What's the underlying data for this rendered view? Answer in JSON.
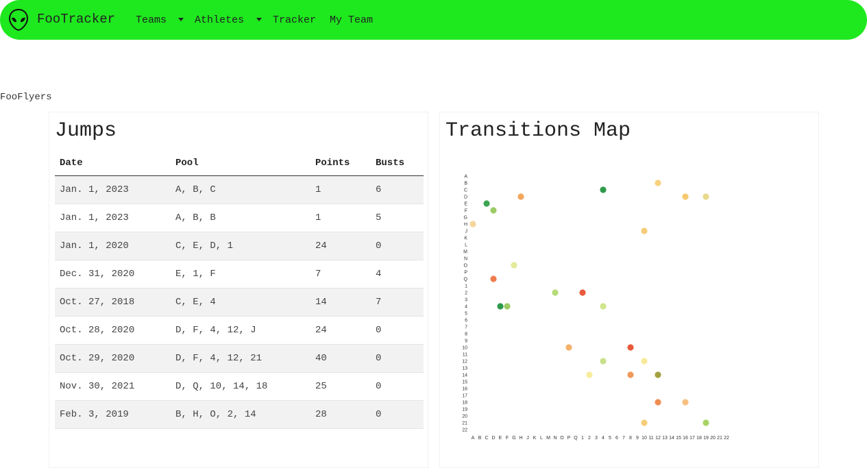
{
  "nav": {
    "brand": "FooTracker",
    "logo_icon": "alien-head-icon",
    "items": [
      {
        "label": "Teams",
        "dropdown": true
      },
      {
        "label": "Athletes",
        "dropdown": true
      },
      {
        "label": "Tracker",
        "dropdown": false
      },
      {
        "label": "My Team",
        "dropdown": false
      }
    ],
    "color": "#1ee81e"
  },
  "team_name": "FooFlyers",
  "jumps": {
    "title": "Jumps",
    "columns": [
      "Date",
      "Pool",
      "Points",
      "Busts"
    ],
    "rows": [
      [
        "Jan. 1, 2023",
        "A, B, C",
        "1",
        "6"
      ],
      [
        "Jan. 1, 2023",
        "A, B, B",
        "1",
        "5"
      ],
      [
        "Jan. 1, 2020",
        "C, E, D, 1",
        "24",
        "0"
      ],
      [
        "Dec. 31, 2020",
        "E, 1, F",
        "7",
        "4"
      ],
      [
        "Oct. 27, 2018",
        "C, E, 4",
        "14",
        "7"
      ],
      [
        "Oct. 28, 2020",
        "D, F, 4, 12, J",
        "24",
        "0"
      ],
      [
        "Oct. 29, 2020",
        "D, F, 4, 12, 21",
        "40",
        "0"
      ],
      [
        "Nov. 30, 2021",
        "D, Q, 10, 14, 18",
        "25",
        "0"
      ],
      [
        "Feb. 3, 2019",
        "B, H, O, 2, 14",
        "28",
        "0"
      ]
    ]
  },
  "transitions": {
    "title": "Transitions Map",
    "chart_data": {
      "type": "heatmap",
      "x_categories": [
        "A",
        "B",
        "C",
        "D",
        "E",
        "F",
        "G",
        "H",
        "J",
        "K",
        "L",
        "M",
        "N",
        "O",
        "P",
        "Q",
        "1",
        "2",
        "3",
        "4",
        "5",
        "6",
        "7",
        "8",
        "9",
        "10",
        "11",
        "12",
        "13",
        "14",
        "15",
        "16",
        "17",
        "18",
        "19",
        "20",
        "21",
        "22"
      ],
      "y_categories": [
        "A",
        "B",
        "C",
        "D",
        "E",
        "F",
        "G",
        "H",
        "J",
        "K",
        "L",
        "M",
        "N",
        "O",
        "P",
        "Q",
        "1",
        "2",
        "3",
        "4",
        "5",
        "6",
        "7",
        "8",
        "9",
        "10",
        "11",
        "12",
        "13",
        "14",
        "15",
        "16",
        "17",
        "18",
        "19",
        "20",
        "21",
        "22"
      ],
      "points": [
        {
          "x": "12",
          "y": "B",
          "color": "#f8d27e"
        },
        {
          "x": "4",
          "y": "C",
          "color": "#2e9a4a"
        },
        {
          "x": "H",
          "y": "D",
          "color": "#f4a55d"
        },
        {
          "x": "16",
          "y": "D",
          "color": "#f6c96e"
        },
        {
          "x": "19",
          "y": "D",
          "color": "#e9d98a"
        },
        {
          "x": "C",
          "y": "E",
          "color": "#3aa552"
        },
        {
          "x": "D",
          "y": "F",
          "color": "#9ccc65"
        },
        {
          "x": "A",
          "y": "H",
          "color": "#f6d59a"
        },
        {
          "x": "10",
          "y": "J",
          "color": "#f6cd78"
        },
        {
          "x": "G",
          "y": "O",
          "color": "#e4ea9a"
        },
        {
          "x": "D",
          "y": "Q",
          "color": "#ee7d4e"
        },
        {
          "x": "N",
          "y": "2",
          "color": "#b5dc78"
        },
        {
          "x": "1",
          "y": "2",
          "color": "#e95a3a"
        },
        {
          "x": "E",
          "y": "4",
          "color": "#2e9a4a"
        },
        {
          "x": "F",
          "y": "4",
          "color": "#9ccc65"
        },
        {
          "x": "4",
          "y": "4",
          "color": "#cfe68a"
        },
        {
          "x": "P",
          "y": "10",
          "color": "#f6b06a"
        },
        {
          "x": "8",
          "y": "10",
          "color": "#e95a3a"
        },
        {
          "x": "4",
          "y": "12",
          "color": "#c9e08a"
        },
        {
          "x": "10",
          "y": "12",
          "color": "#f8ea9a"
        },
        {
          "x": "2",
          "y": "14",
          "color": "#f8ec9c"
        },
        {
          "x": "8",
          "y": "14",
          "color": "#f09a5a"
        },
        {
          "x": "12",
          "y": "14",
          "color": "#a3a040"
        },
        {
          "x": "12",
          "y": "18",
          "color": "#f08e52"
        },
        {
          "x": "16",
          "y": "18",
          "color": "#f6c080"
        },
        {
          "x": "10",
          "y": "21",
          "color": "#f6cd78"
        },
        {
          "x": "19",
          "y": "21",
          "color": "#a8d466"
        }
      ]
    }
  }
}
